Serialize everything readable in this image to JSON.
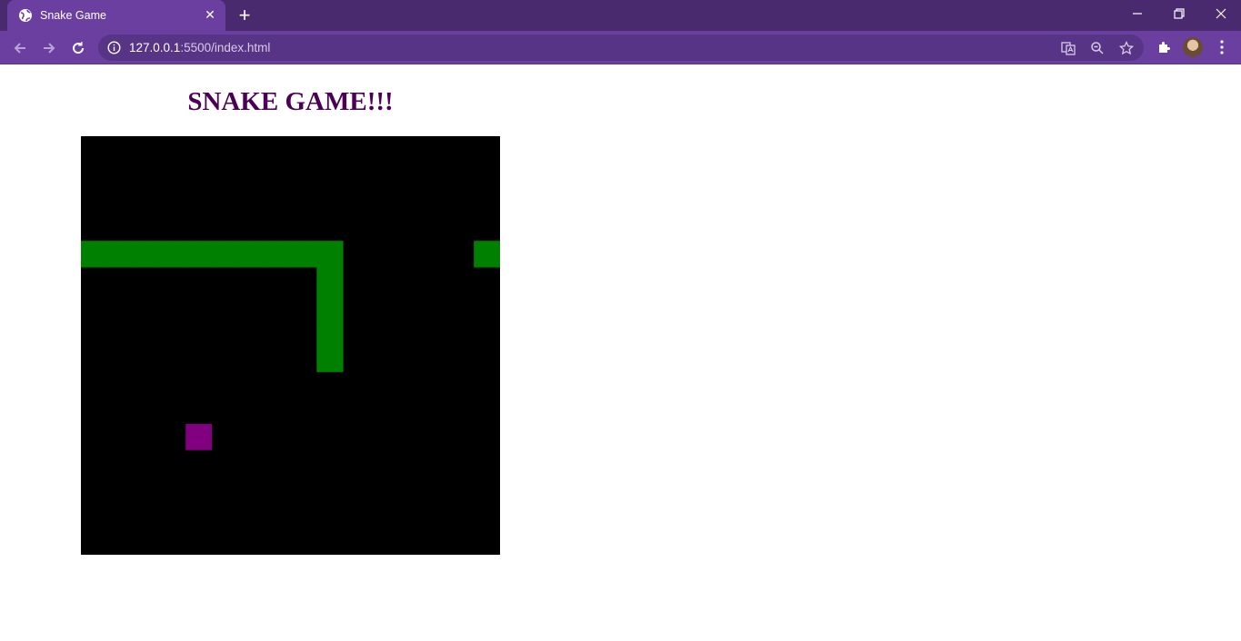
{
  "browser": {
    "tab_title": "Snake Game",
    "tab_close": "✕",
    "new_tab": "+",
    "url_host": "127.0.0.1",
    "url_rest": ":5500/index.html",
    "window_controls": {
      "minimize": "–",
      "maximize": "❐",
      "close": "✕"
    },
    "theme_colors": {
      "titlebar": "#4a2a6e",
      "toolbar": "#6b3fa0",
      "omnibox": "#583486"
    }
  },
  "page": {
    "title": "SNAKE GAME!!!",
    "title_color": "#4b0055"
  },
  "game": {
    "board_color": "#000000",
    "snake_color": "#008000",
    "food_color": "#800080",
    "grid_cells": 16,
    "snake_cells": [
      [
        0,
        4
      ],
      [
        1,
        4
      ],
      [
        2,
        4
      ],
      [
        3,
        4
      ],
      [
        4,
        4
      ],
      [
        5,
        4
      ],
      [
        6,
        4
      ],
      [
        7,
        4
      ],
      [
        8,
        4
      ],
      [
        9,
        4
      ],
      [
        9,
        5
      ],
      [
        9,
        6
      ],
      [
        9,
        7
      ],
      [
        9,
        8
      ],
      [
        15,
        4
      ]
    ],
    "food_cell": [
      4,
      11
    ]
  }
}
